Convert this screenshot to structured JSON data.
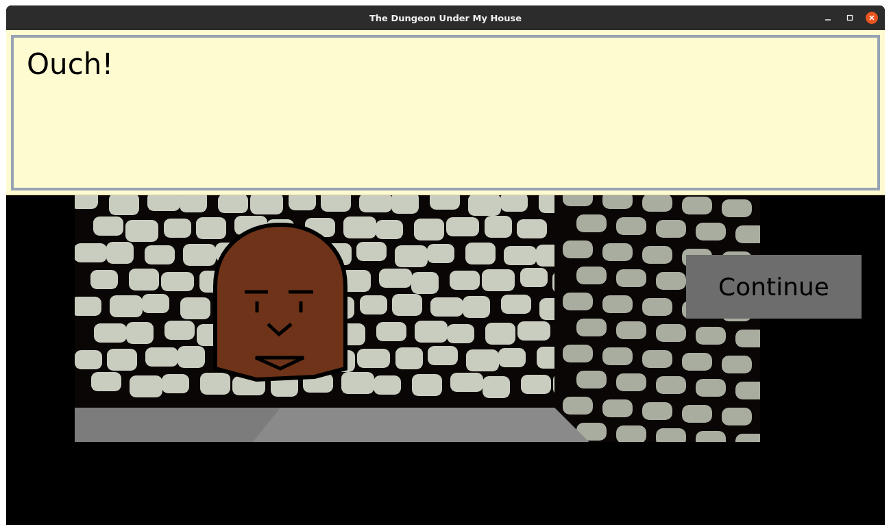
{
  "window": {
    "title": "The Dungeon Under My House"
  },
  "dialog": {
    "text": "Ouch!"
  },
  "buttons": [
    {
      "label": "Continue"
    }
  ]
}
